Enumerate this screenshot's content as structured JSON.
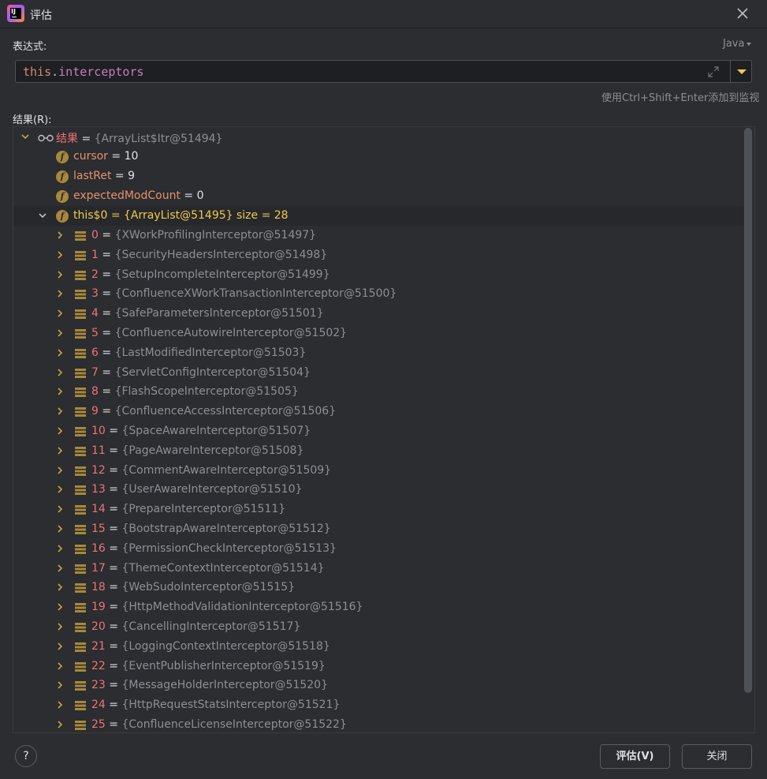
{
  "window": {
    "title": "评估",
    "icon": "intellij-idea-icon"
  },
  "expression": {
    "label": "表达式:",
    "language": "Java",
    "keyword": "this",
    "dot": ".",
    "field": "interceptors",
    "hint": "使用Ctrl+Shift+Enter添加到监视"
  },
  "result": {
    "label": "结果(R):",
    "root": {
      "name": "结果",
      "value": "{ArrayList$Itr@51494}"
    },
    "fields": [
      {
        "name": "cursor",
        "value": "10"
      },
      {
        "name": "lastRet",
        "value": "9"
      },
      {
        "name": "expectedModCount",
        "value": "0"
      }
    ],
    "outer": {
      "name": "this$0",
      "value": "{ArrayList@51495}",
      "size": "size = 28"
    },
    "items": [
      {
        "index": "0",
        "value": "{XWorkProfilingInterceptor@51497}"
      },
      {
        "index": "1",
        "value": "{SecurityHeadersInterceptor@51498}"
      },
      {
        "index": "2",
        "value": "{SetupIncompleteInterceptor@51499}"
      },
      {
        "index": "3",
        "value": "{ConfluenceXWorkTransactionInterceptor@51500}"
      },
      {
        "index": "4",
        "value": "{SafeParametersInterceptor@51501}"
      },
      {
        "index": "5",
        "value": "{ConfluenceAutowireInterceptor@51502}"
      },
      {
        "index": "6",
        "value": "{LastModifiedInterceptor@51503}"
      },
      {
        "index": "7",
        "value": "{ServletConfigInterceptor@51504}"
      },
      {
        "index": "8",
        "value": "{FlashScopeInterceptor@51505}"
      },
      {
        "index": "9",
        "value": "{ConfluenceAccessInterceptor@51506}"
      },
      {
        "index": "10",
        "value": "{SpaceAwareInterceptor@51507}"
      },
      {
        "index": "11",
        "value": "{PageAwareInterceptor@51508}"
      },
      {
        "index": "12",
        "value": "{CommentAwareInterceptor@51509}"
      },
      {
        "index": "13",
        "value": "{UserAwareInterceptor@51510}"
      },
      {
        "index": "14",
        "value": "{PrepareInterceptor@51511}"
      },
      {
        "index": "15",
        "value": "{BootstrapAwareInterceptor@51512}"
      },
      {
        "index": "16",
        "value": "{PermissionCheckInterceptor@51513}"
      },
      {
        "index": "17",
        "value": "{ThemeContextInterceptor@51514}"
      },
      {
        "index": "18",
        "value": "{WebSudoInterceptor@51515}"
      },
      {
        "index": "19",
        "value": "{HttpMethodValidationInterceptor@51516}"
      },
      {
        "index": "20",
        "value": "{CancellingInterceptor@51517}"
      },
      {
        "index": "21",
        "value": "{LoggingContextInterceptor@51518}"
      },
      {
        "index": "22",
        "value": "{EventPublisherInterceptor@51519}"
      },
      {
        "index": "23",
        "value": "{MessageHolderInterceptor@51520}"
      },
      {
        "index": "24",
        "value": "{HttpRequestStatsInterceptor@51521}"
      },
      {
        "index": "25",
        "value": "{ConfluenceLicenseInterceptor@51522}"
      }
    ]
  },
  "buttons": {
    "help": "?",
    "evaluate": "评估(V)",
    "close": "关闭"
  },
  "colors": {
    "background": "#2b2d30",
    "input_bg": "#1e1f22",
    "index_red": "#f07178",
    "field_name": "#e6916b",
    "outer_yellow": "#f2c94c",
    "value_gray": "#8c8f94"
  }
}
